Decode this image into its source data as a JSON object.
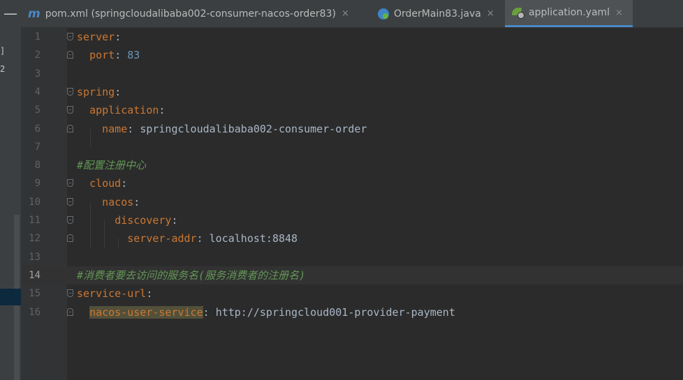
{
  "tabs": [
    {
      "label": "pom.xml (springcloudalibaba002-consumer-nacos-order83)",
      "icon": "maven-m-icon",
      "active": false,
      "close": "×"
    },
    {
      "label": "OrderMain83.java",
      "icon": "java-class-icon",
      "active": false,
      "close": "×"
    },
    {
      "label": "application.yaml",
      "icon": "spring-yaml-icon",
      "active": true,
      "close": "×"
    }
  ],
  "left_strip": {
    "collapse_glyph": "—",
    "glyph1": "]",
    "glyph2": "2"
  },
  "editor": {
    "current_line": 14,
    "lines": [
      {
        "n": "1",
        "indent": "",
        "key": "server",
        "sep": ":",
        "value": "",
        "comment": ""
      },
      {
        "n": "2",
        "indent": "  ",
        "key": "port",
        "sep": ": ",
        "value": "83",
        "comment": ""
      },
      {
        "n": "3",
        "indent": "",
        "key": "",
        "sep": "",
        "value": "",
        "comment": ""
      },
      {
        "n": "4",
        "indent": "",
        "key": "spring",
        "sep": ":",
        "value": "",
        "comment": ""
      },
      {
        "n": "5",
        "indent": "  ",
        "key": "application",
        "sep": ":",
        "value": "",
        "comment": ""
      },
      {
        "n": "6",
        "indent": "    ",
        "key": "name",
        "sep": ": ",
        "value": "springcloudalibaba002-consumer-order",
        "comment": ""
      },
      {
        "n": "7",
        "indent": "",
        "key": "",
        "sep": "",
        "value": "",
        "comment": ""
      },
      {
        "n": "8",
        "indent": "",
        "key": "",
        "sep": "",
        "value": "",
        "comment": "#配置注册中心"
      },
      {
        "n": "9",
        "indent": "  ",
        "key": "cloud",
        "sep": ":",
        "value": "",
        "comment": ""
      },
      {
        "n": "10",
        "indent": "    ",
        "key": "nacos",
        "sep": ":",
        "value": "",
        "comment": ""
      },
      {
        "n": "11",
        "indent": "      ",
        "key": "discovery",
        "sep": ":",
        "value": "",
        "comment": ""
      },
      {
        "n": "12",
        "indent": "        ",
        "key": "server-addr",
        "sep": ": ",
        "value": "localhost:8848",
        "comment": ""
      },
      {
        "n": "13",
        "indent": "",
        "key": "",
        "sep": "",
        "value": "",
        "comment": ""
      },
      {
        "n": "14",
        "indent": "",
        "key": "",
        "sep": "",
        "value": "",
        "comment": "#消费者要去访问的服务名(服务消费者的注册名)"
      },
      {
        "n": "15",
        "indent": "",
        "key": "service-url",
        "sep": ":",
        "value": "",
        "comment": ""
      },
      {
        "n": "16",
        "indent": "  ",
        "key": "nacos-user-service",
        "sep": ": ",
        "value": "http://springcloud001-provider-payment",
        "comment": ""
      }
    ]
  },
  "colors": {
    "keyword": "#cc7832",
    "number": "#6897bb",
    "comment": "#629755",
    "text": "#a9b7c6",
    "background": "#2b2b2b"
  }
}
